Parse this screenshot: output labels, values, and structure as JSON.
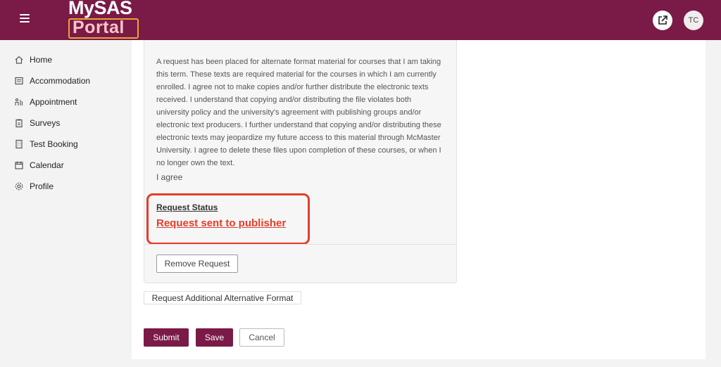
{
  "header": {
    "logo_top": "MySAS",
    "logo_bottom": "Portal",
    "external_link_icon": "external-link-icon",
    "user_initials": "TC",
    "brand_color": "#7a1a47"
  },
  "sidebar": {
    "items": [
      {
        "label": "Home",
        "icon": "home-icon"
      },
      {
        "label": "Accommodation",
        "icon": "document-icon"
      },
      {
        "label": "Appointment",
        "icon": "appointment-icon"
      },
      {
        "label": "Surveys",
        "icon": "clipboard-icon"
      },
      {
        "label": "Test Booking",
        "icon": "building-icon"
      },
      {
        "label": "Calendar",
        "icon": "calendar-icon"
      },
      {
        "label": "Profile",
        "icon": "gear-icon"
      }
    ]
  },
  "request": {
    "agreement_text": "A request has been placed for alternate format material for courses that I am taking this term. These texts are required material for the courses in which I am currently enrolled. I agree not to make copies and/or further distribute the electronic texts received. I understand that copying and/or distributing the file violates both university policy and the university's agreement with publishing groups and/or electronic text producers. I further understand that copying and/or distributing these electronic texts may jeopardize my future access to this material through McMaster University. I agree to delete these files upon completion of these courses, or when I no longer own the text.",
    "agree_label": "I agree",
    "status_label": "Request Status",
    "status_value": "Request sent to publisher",
    "status_color": "#e43d2b",
    "remove_label": "Remove Request"
  },
  "actions": {
    "additional_label": "Request Additional Alternative Format",
    "submit_label": "Submit",
    "save_label": "Save",
    "cancel_label": "Cancel"
  }
}
